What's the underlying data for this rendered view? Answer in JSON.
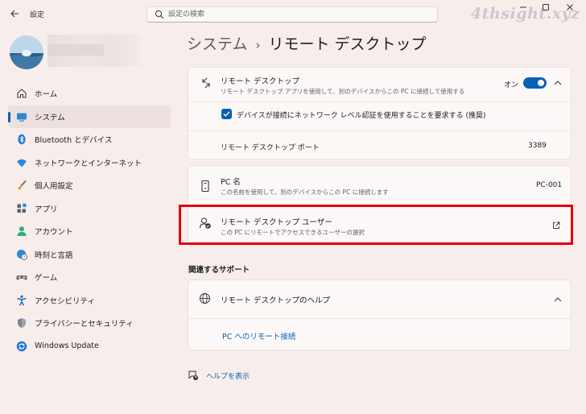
{
  "titlebar": {
    "back_icon": "arrow-left-icon",
    "title": "設定",
    "search_placeholder": "設定の検索",
    "watermark": "4thsight.xyz"
  },
  "breadcrumb": {
    "parent": "システム",
    "separator": "›",
    "current": "リモート デスクトップ"
  },
  "sidebar": {
    "items": [
      {
        "label": "ホーム",
        "icon": "home-icon"
      },
      {
        "label": "システム",
        "icon": "monitor-icon",
        "active": true
      },
      {
        "label": "Bluetooth とデバイス",
        "icon": "bluetooth-icon"
      },
      {
        "label": "ネットワークとインターネット",
        "icon": "wifi-icon"
      },
      {
        "label": "個人用設定",
        "icon": "brush-icon"
      },
      {
        "label": "アプリ",
        "icon": "apps-icon"
      },
      {
        "label": "アカウント",
        "icon": "person-icon"
      },
      {
        "label": "時刻と言語",
        "icon": "globe-clock-icon"
      },
      {
        "label": "ゲーム",
        "icon": "gamepad-icon"
      },
      {
        "label": "アクセシビリティ",
        "icon": "accessibility-icon"
      },
      {
        "label": "プライバシーとセキュリティ",
        "icon": "shield-icon"
      },
      {
        "label": "Windows Update",
        "icon": "update-icon"
      }
    ]
  },
  "remote_desktop": {
    "title": "リモート デスクトップ",
    "description": "リモート デスクトップ アプリを使用して、別のデバイスからこの PC に接続して使用する",
    "toggle_label": "オン",
    "toggle_on": true,
    "nla_checkbox_label": "デバイスが接続にネットワーク レベル認証を使用することを要求する (推奨)",
    "nla_checked": true,
    "port_label": "リモート デスクトップ ポート",
    "port_value": "3389"
  },
  "pc_name": {
    "title": "PC 名",
    "description": "この名前を使用して、別のデバイスからこの PC に接続します",
    "value": "PC-001"
  },
  "users": {
    "title": "リモート デスクトップ ユーザー",
    "description": "この PC にリモートでアクセスできるユーザーの選択"
  },
  "support": {
    "heading": "関連するサポート",
    "help_title": "リモート デスクトップのヘルプ",
    "help_link": "PC へのリモート接続"
  },
  "footer": {
    "show_help": "ヘルプを表示"
  },
  "colors": {
    "accent": "#0a5fb8",
    "highlight": "#e0000c",
    "background": "#f7eeeb"
  }
}
